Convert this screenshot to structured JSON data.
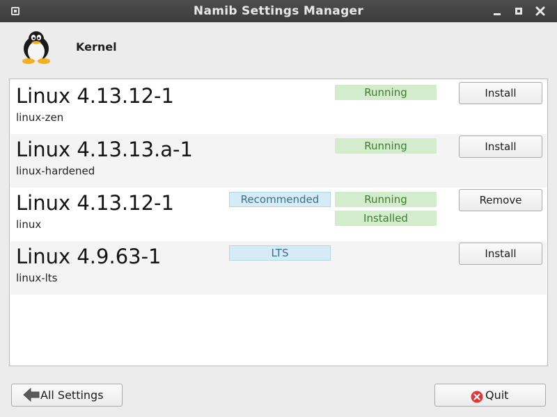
{
  "window": {
    "title": "Namib Settings Manager"
  },
  "header": {
    "icon": "tux-penguin-icon",
    "title": "Kernel"
  },
  "kernels": [
    {
      "name": "Linux 4.13.12-1",
      "package": "linux-zen",
      "badges": [],
      "status": [
        "Running"
      ],
      "action": "Install"
    },
    {
      "name": "Linux 4.13.13.a-1",
      "package": "linux-hardened",
      "badges": [],
      "status": [
        "Running"
      ],
      "action": "Install"
    },
    {
      "name": "Linux 4.13.12-1",
      "package": "linux",
      "badges": [
        "Recommended"
      ],
      "status": [
        "Running",
        "Installed"
      ],
      "action": "Remove"
    },
    {
      "name": "Linux 4.9.63-1",
      "package": "linux-lts",
      "badges": [
        "LTS"
      ],
      "status": [],
      "action": "Install"
    }
  ],
  "footer": {
    "all_settings_label": "All Settings",
    "quit_label": "Quit"
  },
  "colors": {
    "titlebar": "#444444",
    "running_bg": "#d3eccb",
    "running_text": "#3f7b33",
    "info_bg": "#d5ebf6",
    "info_text": "#3b6f8c",
    "quit_icon": "#e0353a"
  }
}
